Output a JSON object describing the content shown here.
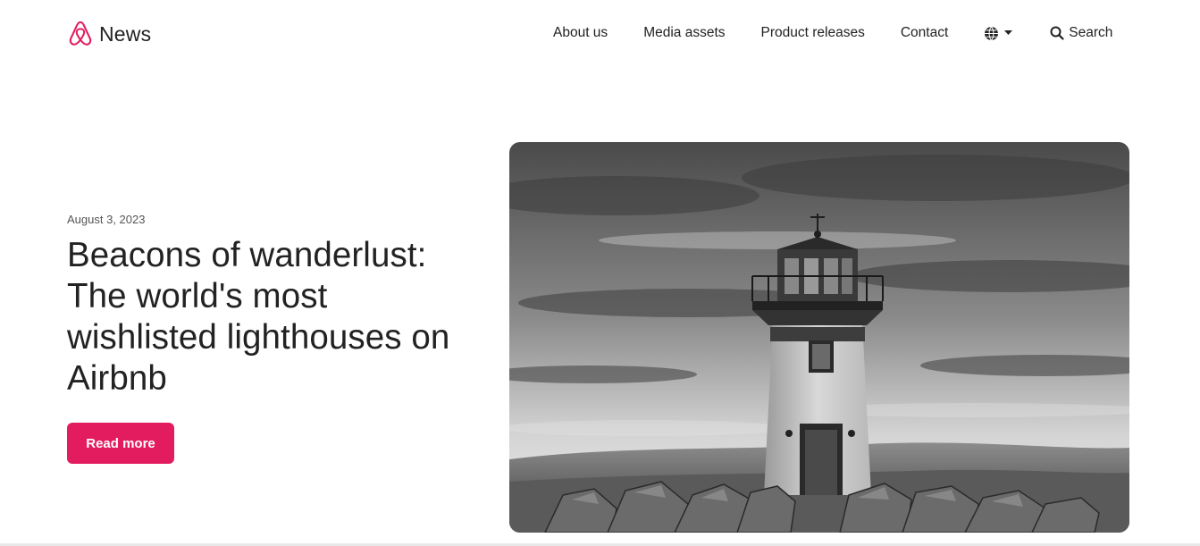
{
  "brand": {
    "name": "News",
    "accent": "#e31c5f"
  },
  "nav": {
    "items": [
      "About us",
      "Media assets",
      "Product releases",
      "Contact"
    ],
    "language_icon": "globe-icon",
    "search_label": "Search"
  },
  "hero": {
    "date": "August 3, 2023",
    "title": "Beacons of wanderlust: The world's most wishlisted lighthouses on Airbnb",
    "cta_label": "Read more",
    "image_icon": "lighthouse-photo"
  }
}
